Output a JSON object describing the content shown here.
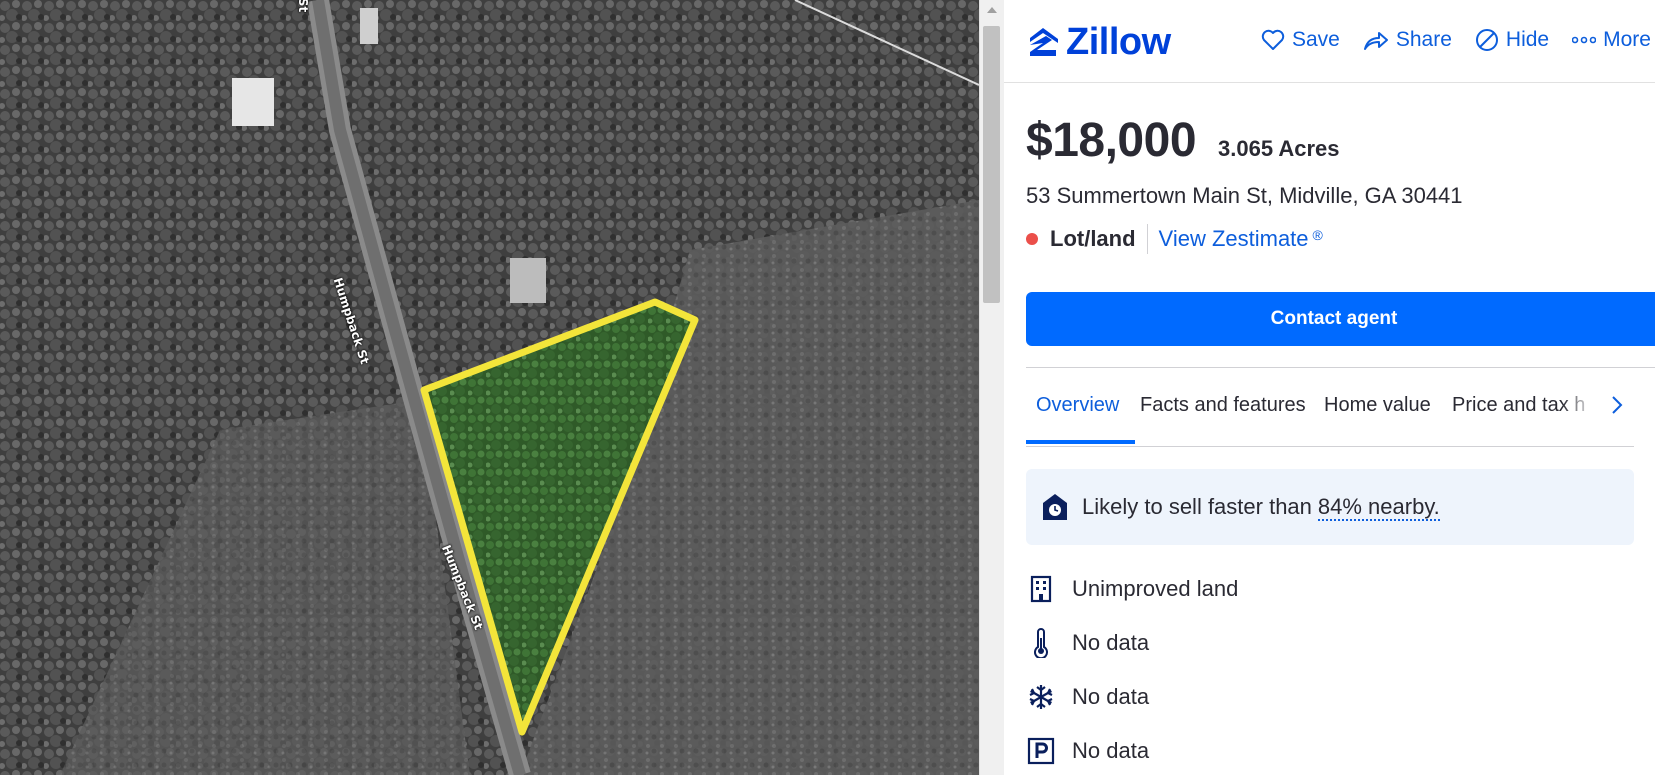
{
  "map": {
    "road_labels": [
      "St",
      "Humpback St",
      "Humpback St"
    ]
  },
  "header": {
    "logo_text": "Zillow",
    "actions": [
      {
        "label": "Save",
        "icon": "heart-icon"
      },
      {
        "label": "Share",
        "icon": "share-icon"
      },
      {
        "label": "Hide",
        "icon": "hide-icon"
      },
      {
        "label": "More",
        "icon": "more-icon"
      }
    ]
  },
  "listing": {
    "price": "$18,000",
    "acres": "3.065 Acres",
    "address": "53 Summertown Main St, Midville, GA 30441",
    "status": "Lot/land",
    "status_color": "#eb4f4a",
    "zestimate_label": "View Zestimate",
    "zestimate_mark": "®"
  },
  "contact_button": "Contact agent",
  "tabs": [
    "Overview",
    "Facts and features",
    "Home value",
    "Price and tax h"
  ],
  "insight": {
    "text": "Likely to sell faster than",
    "link": "84% nearby."
  },
  "facts": [
    {
      "icon": "building-icon",
      "text": "Unimproved land"
    },
    {
      "icon": "thermometer-icon",
      "text": "No data"
    },
    {
      "icon": "snowflake-icon",
      "text": "No data"
    },
    {
      "icon": "parking-icon",
      "text": "No data"
    }
  ],
  "colors": {
    "brand_blue": "#006aff",
    "link_blue": "#0d5edc",
    "logo_blue": "#0041d9",
    "parcel_outline": "#f3e53a"
  }
}
